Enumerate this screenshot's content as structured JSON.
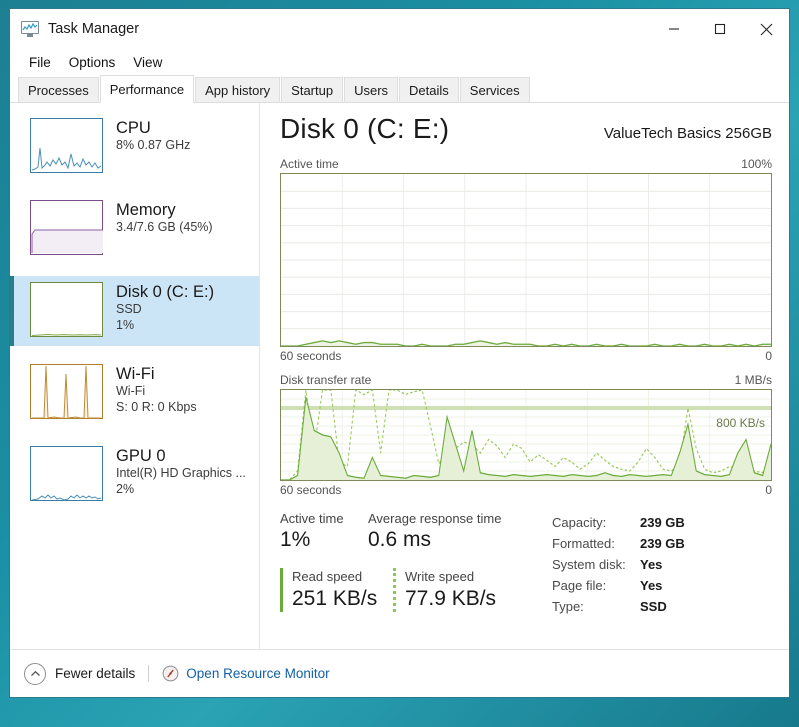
{
  "window": {
    "title": "Task Manager",
    "icon": "task-manager-icon",
    "controls": {
      "minimize": "minimize-icon",
      "maximize": "maximize-icon",
      "close": "close-icon"
    }
  },
  "menu": {
    "items": [
      "File",
      "Options",
      "View"
    ]
  },
  "tabs": {
    "items": [
      "Processes",
      "Performance",
      "App history",
      "Startup",
      "Users",
      "Details",
      "Services"
    ],
    "active": "Performance"
  },
  "sidebar": {
    "items": [
      {
        "title": "CPU",
        "line1": "8% 0.87 GHz",
        "line2": "",
        "color": "#3a7ca5",
        "selected": false
      },
      {
        "title": "Memory",
        "line1": "3.4/7.6 GB (45%)",
        "line2": "",
        "color": "#7b4b8a",
        "selected": false
      },
      {
        "title": "Disk 0 (C: E:)",
        "line1": "SSD",
        "line2": "1%",
        "color": "#6f8b3f",
        "selected": true
      },
      {
        "title": "Wi-Fi",
        "line1": "Wi-Fi",
        "line2": "S: 0 R: 0 Kbps",
        "color": "#b07d2a",
        "selected": false
      },
      {
        "title": "GPU 0",
        "line1": "Intel(R) HD Graphics ...",
        "line2": "2%",
        "color": "#3a7ca5",
        "selected": false
      }
    ]
  },
  "main": {
    "title": "Disk 0 (C: E:)",
    "device": "ValueTech Basics 256GB",
    "active_graph": {
      "label": "Active time",
      "max_label": "100%",
      "footer_left": "60 seconds",
      "footer_right": "0"
    },
    "rate_graph": {
      "label": "Disk transfer rate",
      "max_label": "1 MB/s",
      "marker_label": "800 KB/s",
      "footer_left": "60 seconds",
      "footer_right": "0"
    },
    "stats": {
      "active_time_label": "Active time",
      "active_time_value": "1%",
      "avg_response_label": "Average response time",
      "avg_response_value": "0.6 ms",
      "read_label": "Read speed",
      "read_value": "251 KB/s",
      "write_label": "Write speed",
      "write_value": "77.9 KB/s",
      "details": [
        {
          "key": "Capacity:",
          "value": "239 GB"
        },
        {
          "key": "Formatted:",
          "value": "239 GB"
        },
        {
          "key": "System disk:",
          "value": "Yes"
        },
        {
          "key": "Page file:",
          "value": "Yes"
        },
        {
          "key": "Type:",
          "value": "SSD"
        }
      ]
    }
  },
  "footer": {
    "fewer_details": "Fewer details",
    "open_resource_monitor": "Open Resource Monitor"
  },
  "colors": {
    "accent": "#2a7d8c",
    "selection": "#cce5f6",
    "disk_green": "#6aab3a",
    "graph_border": "#7e8a5c",
    "link": "#1160a8",
    "desktop": "#1b8fa3"
  },
  "chart_data": [
    {
      "type": "area",
      "title": "Active time",
      "ylabel": "%",
      "xlabel": "60 seconds",
      "ylim": [
        0,
        100
      ],
      "grid": true,
      "series": [
        {
          "name": "Active time",
          "values": [
            0,
            0,
            0,
            1,
            2,
            3,
            2,
            3,
            2,
            1,
            2,
            2,
            1,
            1,
            1,
            0,
            0,
            1,
            0,
            0,
            0,
            1,
            1,
            2,
            3,
            2,
            1,
            2,
            1,
            1,
            1,
            0,
            0,
            1,
            0,
            1,
            0,
            0,
            1,
            0,
            0,
            1,
            0,
            0,
            0,
            1,
            0,
            0,
            1,
            0,
            0,
            1,
            0,
            0,
            1,
            0,
            1,
            0,
            1,
            1
          ]
        }
      ]
    },
    {
      "type": "line",
      "title": "Disk transfer rate",
      "ylabel": "MB/s",
      "xlabel": "60 seconds",
      "ylim": [
        0,
        1
      ],
      "annotations": [
        "800 KB/s"
      ],
      "grid": true,
      "series": [
        {
          "name": "Write speed",
          "style": "solid",
          "values": [
            0,
            0,
            0.05,
            0.92,
            0.55,
            0.5,
            0.48,
            0.3,
            0.05,
            0.03,
            0.02,
            0.25,
            0.05,
            0.04,
            0.03,
            0.02,
            0.05,
            0.04,
            0.03,
            0.05,
            0.7,
            0.4,
            0.1,
            0.55,
            0.08,
            0.06,
            0.05,
            0.04,
            0.06,
            0.05,
            0.04,
            0.05,
            0.06,
            0.05,
            0.04,
            0.06,
            0.05,
            0.04,
            0.05,
            0.08,
            0.05,
            0.04,
            0.06,
            0.05,
            0.04,
            0.05,
            0.06,
            0.05,
            0.3,
            0.62,
            0.1,
            0.06,
            0.05,
            0.04,
            0.06,
            0.3,
            0.45,
            0.08,
            0.05,
            0.4
          ]
        },
        {
          "name": "Read speed",
          "style": "dashed",
          "values": [
            0,
            0,
            0.1,
            1.0,
            0.35,
            1.0,
            1.0,
            0.2,
            0.15,
            1.0,
            0.95,
            1.0,
            0.3,
            1.0,
            1.0,
            0.95,
            0.98,
            1.0,
            0.6,
            0.18,
            0.3,
            0.35,
            0.42,
            0.4,
            0.3,
            0.45,
            0.38,
            0.25,
            0.4,
            0.35,
            0.2,
            0.28,
            0.22,
            0.15,
            0.25,
            0.2,
            0.12,
            0.18,
            0.3,
            0.22,
            0.15,
            0.12,
            0.1,
            0.2,
            0.35,
            0.25,
            0.12,
            0.1,
            0.18,
            0.8,
            0.35,
            0.12,
            0.08,
            0.1,
            0.15,
            0.12,
            0.2,
            0.1,
            0.08,
            0.3
          ]
        }
      ]
    }
  ]
}
